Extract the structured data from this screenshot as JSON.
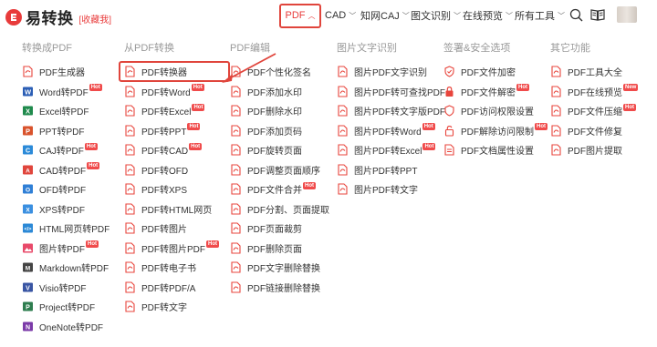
{
  "header": {
    "logo_text": "易转换",
    "favorite_label": "[收藏我]",
    "nav": [
      {
        "label": "PDF",
        "caret": "^",
        "active": true
      },
      {
        "label": "CAD",
        "caret": "v"
      },
      {
        "label": "知网CAJ",
        "caret": "v"
      },
      {
        "label": "图文识别",
        "caret": "v"
      },
      {
        "label": "在线预览",
        "caret": "v"
      },
      {
        "label": "所有工具",
        "caret": "v"
      }
    ],
    "icons": [
      "search-icon",
      "book-icon",
      "avatar"
    ]
  },
  "colors": {
    "accent": "#e83b3b",
    "highlight_border": "#e0453c",
    "pdf_red": "#e8453c",
    "title_gray": "#999999"
  },
  "menu": {
    "columns": [
      {
        "title": "转换成PDF",
        "items": [
          {
            "label": "PDF生成器",
            "icon": "pdf-generator-icon"
          },
          {
            "label": "Word转PDF",
            "badge": "Hot",
            "icon": "word-icon"
          },
          {
            "label": "Excel转PDF",
            "icon": "excel-icon"
          },
          {
            "label": "PPT转PDF",
            "icon": "ppt-icon"
          },
          {
            "label": "CAJ转PDF",
            "badge": "Hot",
            "icon": "caj-icon"
          },
          {
            "label": "CAD转PDF",
            "badge": "Hot",
            "icon": "cad-icon"
          },
          {
            "label": "OFD转PDF",
            "icon": "ofd-icon"
          },
          {
            "label": "XPS转PDF",
            "icon": "xps-icon"
          },
          {
            "label": "HTML网页转PDF",
            "icon": "html-icon"
          },
          {
            "label": "图片转PDF",
            "badge": "Hot",
            "icon": "image-icon"
          },
          {
            "label": "Markdown转PDF",
            "icon": "markdown-icon"
          },
          {
            "label": "Visio转PDF",
            "icon": "visio-icon"
          },
          {
            "label": "Project转PDF",
            "icon": "project-icon"
          },
          {
            "label": "OneNote转PDF",
            "icon": "onenote-icon"
          }
        ]
      },
      {
        "title": "从PDF转换",
        "items": [
          {
            "label": "PDF转换器",
            "icon": "pdf-converter-icon",
            "highlight": true
          },
          {
            "label": "PDF转Word",
            "badge": "Hot",
            "icon": "pdf-icon"
          },
          {
            "label": "PDF转Excel",
            "badge": "Hot",
            "icon": "pdf-icon"
          },
          {
            "label": "PDF转PPT",
            "badge": "Hot",
            "icon": "pdf-icon"
          },
          {
            "label": "PDF转CAD",
            "badge": "Hot",
            "icon": "pdf-icon"
          },
          {
            "label": "PDF转OFD",
            "icon": "pdf-icon"
          },
          {
            "label": "PDF转XPS",
            "icon": "pdf-icon"
          },
          {
            "label": "PDF转HTML网页",
            "icon": "pdf-icon"
          },
          {
            "label": "PDF转图片",
            "icon": "pdf-icon"
          },
          {
            "label": "PDF转图片PDF",
            "badge": "Hot",
            "icon": "pdf-icon"
          },
          {
            "label": "PDF转电子书",
            "icon": "pdf-icon"
          },
          {
            "label": "PDF转PDF/A",
            "icon": "pdf-icon"
          },
          {
            "label": "PDF转文字",
            "icon": "pdf-icon"
          }
        ]
      },
      {
        "title": "PDF编辑",
        "items": [
          {
            "label": "PDF个性化签名",
            "icon": "pdf-icon"
          },
          {
            "label": "PDF添加水印",
            "icon": "pdf-icon"
          },
          {
            "label": "PDF删除水印",
            "icon": "pdf-icon"
          },
          {
            "label": "PDF添加页码",
            "icon": "pdf-icon"
          },
          {
            "label": "PDF旋转页面",
            "icon": "pdf-icon"
          },
          {
            "label": "PDF调整页面顺序",
            "icon": "pdf-icon"
          },
          {
            "label": "PDF文件合并",
            "badge": "Hot",
            "icon": "pdf-icon"
          },
          {
            "label": "PDF分割、页面提取",
            "icon": "pdf-icon"
          },
          {
            "label": "PDF页面裁剪",
            "icon": "pdf-icon"
          },
          {
            "label": "PDF删除页面",
            "icon": "pdf-icon"
          },
          {
            "label": "PDF文字删除替换",
            "icon": "pdf-icon"
          },
          {
            "label": "PDF链接删除替换",
            "icon": "pdf-icon"
          }
        ]
      },
      {
        "title": "图片文字识别",
        "items": [
          {
            "label": "图片PDF文字识别",
            "icon": "pdf-icon"
          },
          {
            "label": "图片PDF转可查找PDF",
            "icon": "pdf-icon"
          },
          {
            "label": "图片PDF转文字版PDF",
            "icon": "pdf-icon"
          },
          {
            "label": "图片PDF转Word",
            "badge": "Hot",
            "icon": "pdf-icon"
          },
          {
            "label": "图片PDF转Excel",
            "badge": "Hot",
            "icon": "pdf-icon"
          },
          {
            "label": "图片PDF转PPT",
            "icon": "pdf-icon"
          },
          {
            "label": "图片PDF转文字",
            "icon": "pdf-icon"
          }
        ]
      },
      {
        "title": "签署&安全选项",
        "items": [
          {
            "label": "PDF文件加密",
            "icon": "shield-icon"
          },
          {
            "label": "PDF文件解密",
            "badge": "Hot",
            "icon": "lock-icon"
          },
          {
            "label": "PDF访问权限设置",
            "icon": "shield-outline-icon"
          },
          {
            "label": "PDF解除访问限制",
            "badge": "Hot",
            "icon": "unlock-icon"
          },
          {
            "label": "PDF文档属性设置",
            "icon": "document-settings-icon"
          }
        ]
      },
      {
        "title": "其它功能",
        "items": [
          {
            "label": "PDF工具大全",
            "icon": "pdf-icon"
          },
          {
            "label": "PDF在线预览",
            "badge": "New",
            "icon": "pdf-icon"
          },
          {
            "label": "PDF文件压缩",
            "badge": "Hot",
            "icon": "pdf-icon"
          },
          {
            "label": "PDF文件修复",
            "icon": "pdf-icon"
          },
          {
            "label": "PDF图片提取",
            "icon": "pdf-icon"
          }
        ]
      }
    ]
  }
}
